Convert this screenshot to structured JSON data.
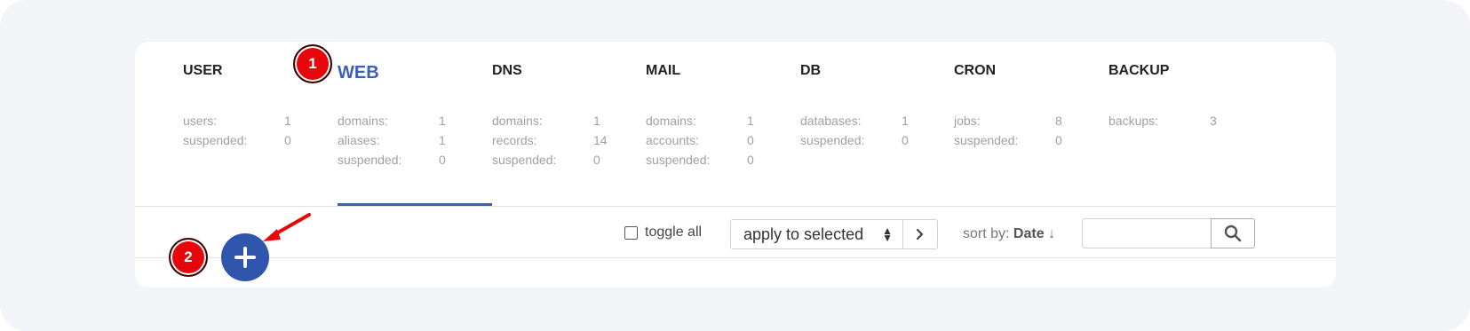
{
  "tabs": [
    {
      "title": "USER",
      "stats": [
        {
          "label": "users:",
          "value": "1"
        },
        {
          "label": "suspended:",
          "value": "0"
        }
      ]
    },
    {
      "title": "WEB",
      "active": true,
      "stats": [
        {
          "label": "domains:",
          "value": "1"
        },
        {
          "label": "aliases:",
          "value": "1"
        },
        {
          "label": "suspended:",
          "value": "0"
        }
      ]
    },
    {
      "title": "DNS",
      "stats": [
        {
          "label": "domains:",
          "value": "1"
        },
        {
          "label": "records:",
          "value": "14"
        },
        {
          "label": "suspended:",
          "value": "0"
        }
      ]
    },
    {
      "title": "MAIL",
      "stats": [
        {
          "label": "domains:",
          "value": "1"
        },
        {
          "label": "accounts:",
          "value": "0"
        },
        {
          "label": "suspended:",
          "value": "0"
        }
      ]
    },
    {
      "title": "DB",
      "stats": [
        {
          "label": "databases:",
          "value": "1"
        },
        {
          "label": "suspended:",
          "value": "0"
        }
      ]
    },
    {
      "title": "CRON",
      "stats": [
        {
          "label": "jobs:",
          "value": "8"
        },
        {
          "label": "suspended:",
          "value": "0"
        }
      ]
    },
    {
      "title": "BACKUP",
      "stats": [
        {
          "label": "backups:",
          "value": "3"
        }
      ]
    }
  ],
  "toolbar": {
    "toggle_all_label": "toggle all",
    "bulk_action_selected": "apply to selected",
    "sort_prefix": "sort by:",
    "sort_field": "Date",
    "sort_direction": "↓",
    "search_value": ""
  },
  "annotations": {
    "marker1": "1",
    "marker2": "2"
  },
  "colors": {
    "accent": "#2f55ad",
    "marker": "#e8060c"
  }
}
